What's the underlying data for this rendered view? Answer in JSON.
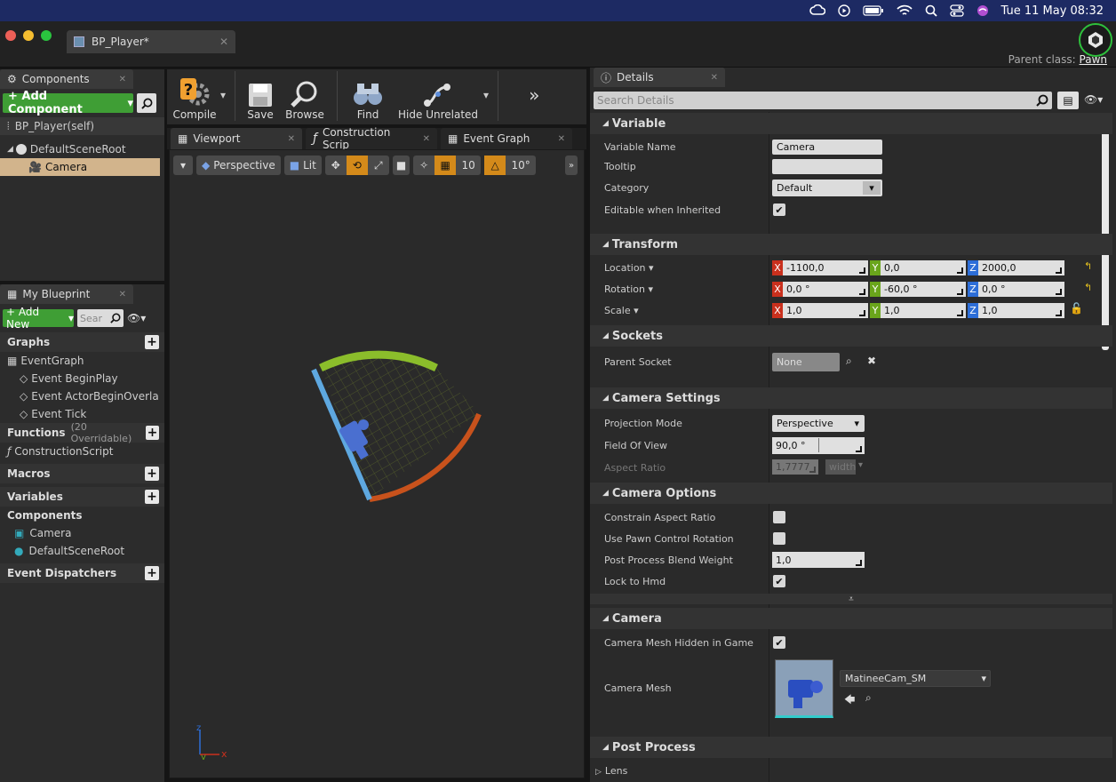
{
  "menubar": {
    "datetime": "Tue 11 May  08:32"
  },
  "window": {
    "doc_tab": "BP_Player*",
    "parent_class_label": "Parent class:",
    "parent_class_value": "Pawn"
  },
  "components_panel": {
    "tab": "Components",
    "add_button": "+ Add Component",
    "self_item": "BP_Player(self)",
    "tree": [
      "DefaultSceneRoot",
      "Camera"
    ]
  },
  "my_blueprint": {
    "tab": "My Blueprint",
    "add_new": "+ Add New",
    "search_placeholder": "Sear",
    "graphs_header": "Graphs",
    "event_graph": "EventGraph",
    "events": [
      "Event BeginPlay",
      "Event ActorBeginOverla",
      "Event Tick"
    ],
    "functions_header": "Functions",
    "functions_count": "(20 Overridable)",
    "construction_script": "ConstructionScript",
    "macros_header": "Macros",
    "variables_header": "Variables",
    "components_header": "Components",
    "component_vars": [
      "Camera",
      "DefaultSceneRoot"
    ],
    "dispatchers_header": "Event Dispatchers"
  },
  "toolbar": {
    "compile": "Compile",
    "save": "Save",
    "browse": "Browse",
    "find": "Find",
    "hide_unrelated": "Hide Unrelated"
  },
  "editor_tabs": [
    "Viewport",
    "Construction Scrip",
    "Event Graph"
  ],
  "viewport_bar": {
    "perspective": "Perspective",
    "lit": "Lit",
    "grid_snap": "10",
    "rot_snap": "10°"
  },
  "details": {
    "tab": "Details",
    "search_placeholder": "Search Details",
    "variable": {
      "header": "Variable",
      "name_label": "Variable Name",
      "name_value": "Camera",
      "tooltip_label": "Tooltip",
      "category_label": "Category",
      "category_value": "Default",
      "editable_label": "Editable when Inherited"
    },
    "transform": {
      "header": "Transform",
      "location_label": "Location",
      "rotation_label": "Rotation",
      "scale_label": "Scale",
      "location": [
        "-1100,0",
        "0,0",
        "2000,0"
      ],
      "rotation": [
        "0,0 °",
        "-60,0 °",
        "0,0 °"
      ],
      "scale": [
        "1,0",
        "1,0",
        "1,0"
      ]
    },
    "sockets": {
      "header": "Sockets",
      "parent_label": "Parent Socket",
      "parent_value": "None"
    },
    "camera_settings": {
      "header": "Camera Settings",
      "projection_label": "Projection Mode",
      "projection_value": "Perspective",
      "fov_label": "Field Of View",
      "fov_value": "90,0 °",
      "aspect_label": "Aspect Ratio",
      "aspect_value": "1,7777",
      "aspect_unit": "width"
    },
    "camera_options": {
      "header": "Camera Options",
      "constrain_label": "Constrain Aspect Ratio",
      "pawn_rot_label": "Use Pawn Control Rotation",
      "blend_label": "Post Process Blend Weight",
      "blend_value": "1,0",
      "hmd_label": "Lock to Hmd"
    },
    "camera": {
      "header": "Camera",
      "hidden_label": "Camera Mesh Hidden in Game",
      "mesh_label": "Camera Mesh",
      "mesh_value": "MatineeCam_SM"
    },
    "post_process": {
      "header": "Post Process",
      "lens_label": "Lens"
    }
  },
  "colors": {
    "x_axis": "#c9301d",
    "y_axis": "#6aa51b",
    "z_axis": "#2d6ed8",
    "accent_green": "#3f9e35"
  }
}
